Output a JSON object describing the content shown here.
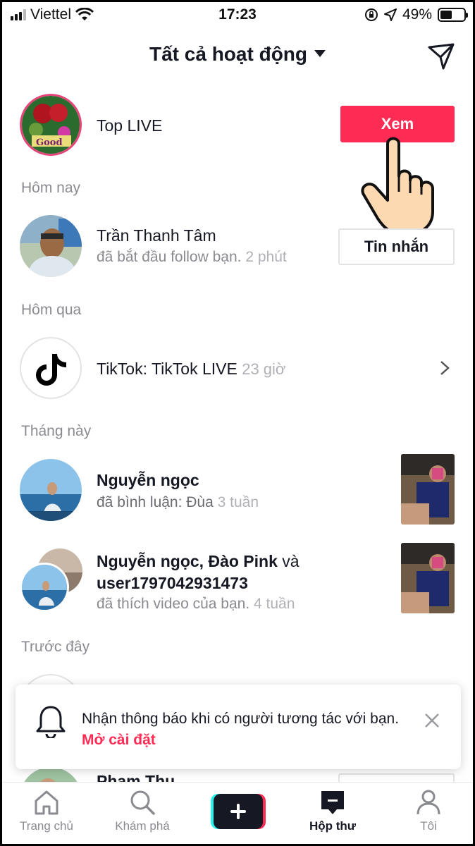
{
  "status_bar": {
    "carrier": "Viettel",
    "time": "17:23",
    "battery": "49%"
  },
  "header": {
    "title": "Tất cả hoạt động"
  },
  "top_live": {
    "name": "Top LIVE",
    "button": "Xem"
  },
  "sections": {
    "today": "Hôm nay",
    "yesterday": "Hôm qua",
    "this_month": "Tháng này",
    "earlier": "Trước đây"
  },
  "activities": {
    "follow": {
      "name": "Trần Thanh Tâm",
      "text": "đã bắt đầu follow bạn.",
      "time": "2 phút",
      "button": "Tin nhắn"
    },
    "tiktok": {
      "name": "TikTok",
      "text": ": TikTok LIVE",
      "time": "23 giờ"
    },
    "comment": {
      "name": "Nguyễn ngọc",
      "text": "đã bình luận: Đùa",
      "time": "3 tuần"
    },
    "likes": {
      "name1": "Nguyễn ngọc",
      "sep": ", ",
      "name2": "Đào Pink",
      "and": " và",
      "name3": "user1797042931473",
      "text": "đã thích video của bạn.",
      "time": "4 tuần"
    },
    "earlier_partial": {
      "name": "Pham Thu"
    }
  },
  "notice": {
    "text": "Nhận thông báo khi có người tương tác với bạn.",
    "link": "Mở cài đặt"
  },
  "bottom_nav": {
    "home": "Trang chủ",
    "discover": "Khám phá",
    "inbox": "Hộp thư",
    "me": "Tôi"
  },
  "colors": {
    "accent": "#fe2c55",
    "cyan": "#25f4ee",
    "text": "#161823",
    "muted": "#8a8b91"
  }
}
